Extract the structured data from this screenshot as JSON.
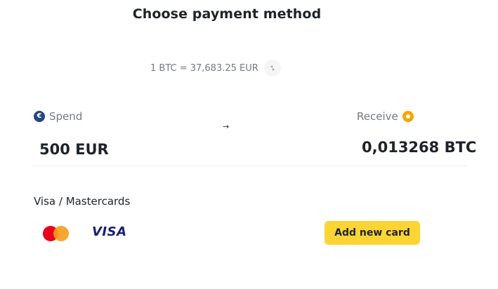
{
  "header": {
    "title": "Choose payment method"
  },
  "rate": {
    "text": "1 BTC = 37,683.25 EUR",
    "refresh_icon": "refresh-icon"
  },
  "spend": {
    "label": "Spend",
    "currency_icon": "euro-coin-icon",
    "amount": "500 EUR"
  },
  "conversion_arrow": "→",
  "receive": {
    "label": "Receive",
    "currency_icon": "bitcoin-coin-icon",
    "amount": "0,013268 BTC"
  },
  "payment": {
    "section_label": "Visa / Mastercards",
    "brands": [
      "Mastercard",
      "VISA"
    ],
    "visa_text": "VISA",
    "add_card_label": "Add new card"
  },
  "colors": {
    "accent": "#fcd535",
    "text_primary": "#1e2329",
    "text_secondary": "#707a8a",
    "euro_coin": "#25467f",
    "bitcoin_coin": "#f7a600"
  }
}
